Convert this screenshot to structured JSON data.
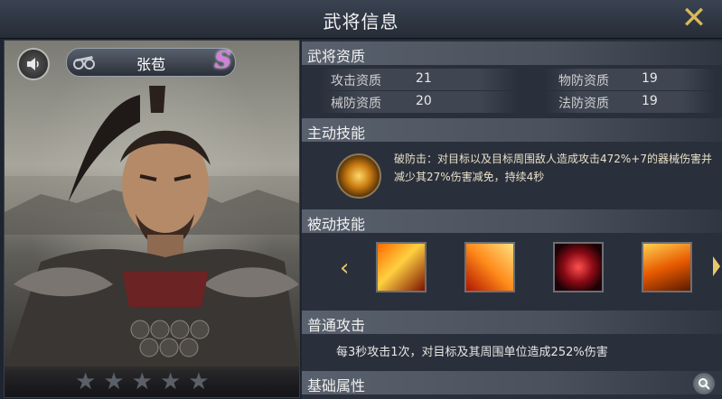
{
  "header": {
    "title": "武将信息",
    "close_icon": "close-icon"
  },
  "hero": {
    "name": "张苞",
    "rank": "S",
    "unit_icon": "chariot-icon",
    "stars_total": 5,
    "stars_filled": 0
  },
  "sections": {
    "aptitude": {
      "title": "武将资质",
      "rows": [
        {
          "label": "攻击资质",
          "value": "21"
        },
        {
          "label": "物防资质",
          "value": "19"
        },
        {
          "label": "械防资质",
          "value": "20"
        },
        {
          "label": "法防资质",
          "value": "19"
        }
      ]
    },
    "active": {
      "title": "主动技能",
      "text": "破防击：对目标以及目标周围敌人造成攻击472%+7的器械伤害并减少其27%伤害减免，持续4秒"
    },
    "passive": {
      "title": "被动技能"
    },
    "normal": {
      "title": "普通攻击",
      "text": "每3秒攻击1次，对目标及其周围单位造成252%伤害"
    },
    "basic": {
      "title": "基础属性"
    }
  },
  "colors": {
    "accent_gold": "#d8b85a",
    "rank_pink": "#d87be0",
    "panel_bg": "#2a303b"
  }
}
